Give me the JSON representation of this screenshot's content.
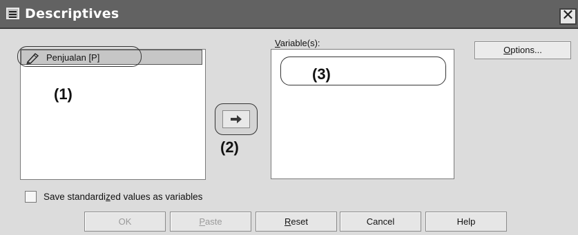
{
  "window": {
    "title": "Descriptives",
    "close_glyph": "✕"
  },
  "source_list": {
    "items": [
      {
        "label": "Penjualan [P]",
        "icon": "pencil-icon"
      }
    ]
  },
  "markers": {
    "m1": "(1)",
    "m2": "(2)",
    "m3": "(3)"
  },
  "variables": {
    "label_underlined": "V",
    "label_rest": "ariable(s):"
  },
  "options_button": {
    "underlined": "O",
    "rest": "ptions..."
  },
  "arrow_glyph": "➜",
  "checkbox": {
    "label_pre": "Save standardi",
    "label_underlined": "z",
    "label_post": "ed values as variables",
    "checked": false
  },
  "buttons": {
    "ok": "OK",
    "paste_u": "P",
    "paste_rest": "aste",
    "reset_u": "R",
    "reset_rest": "eset",
    "cancel": "Cancel",
    "help": "Help"
  }
}
